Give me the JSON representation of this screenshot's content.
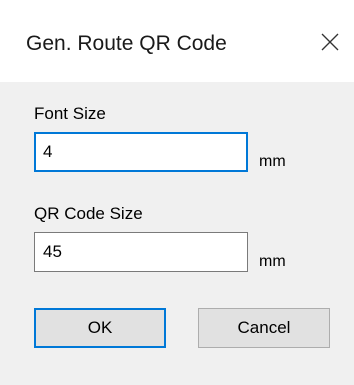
{
  "dialog": {
    "title": "Gen. Route QR Code",
    "close_icon": "close-icon"
  },
  "fields": {
    "font_size": {
      "label": "Font Size",
      "value": "4",
      "unit": "mm",
      "focused": true
    },
    "qr_code_size": {
      "label": "QR Code Size",
      "value": "45",
      "unit": "mm",
      "focused": false
    }
  },
  "buttons": {
    "ok_label": "OK",
    "cancel_label": "Cancel"
  },
  "colors": {
    "accent": "#0078d7",
    "content_background": "#f0f0f0",
    "button_background": "#e1e1e1",
    "input_border": "#7a7a7a"
  }
}
